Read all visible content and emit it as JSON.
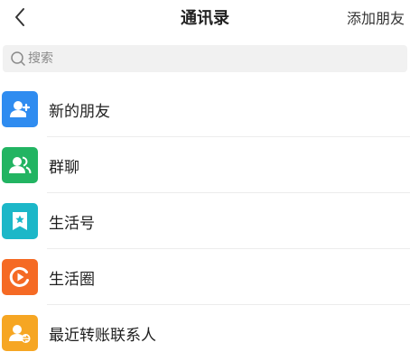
{
  "header": {
    "back_icon": "chevron-left-icon",
    "title": "通讯录",
    "add_friend_label": "添加朋友"
  },
  "search": {
    "placeholder": "搜索",
    "value": "",
    "icon": "search-icon"
  },
  "list": {
    "items": [
      {
        "label": "新的朋友",
        "icon": "add-person-icon",
        "color": "#2f8cf0"
      },
      {
        "label": "群聊",
        "icon": "group-icon",
        "color": "#22b462"
      },
      {
        "label": "生活号",
        "icon": "star-bookmark-icon",
        "color": "#1cb7c8"
      },
      {
        "label": "生活圈",
        "icon": "play-circle-icon",
        "color": "#f56a24"
      },
      {
        "label": "最近转账联系人",
        "icon": "transfer-person-icon",
        "color": "#f6a623"
      }
    ]
  }
}
